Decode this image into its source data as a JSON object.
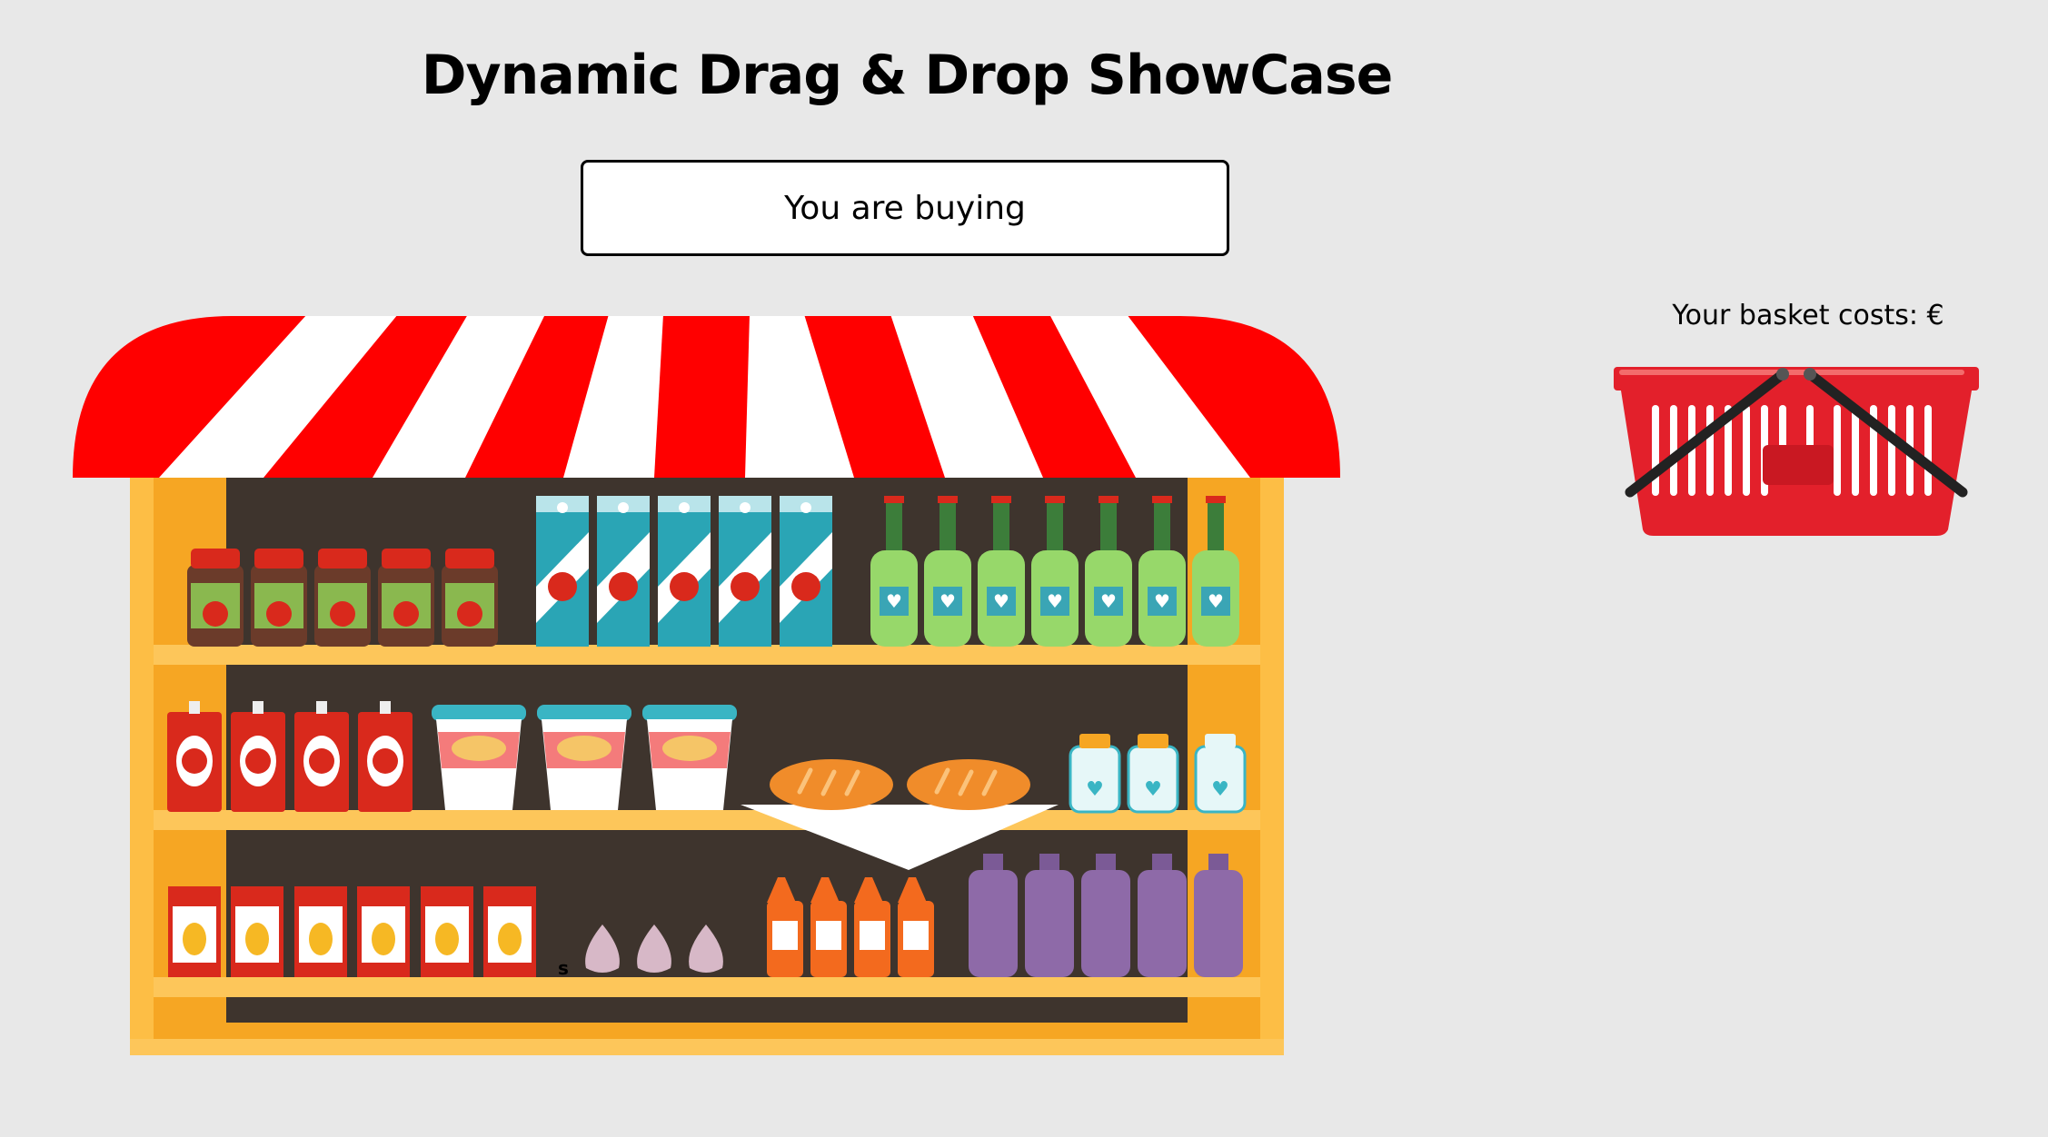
{
  "page": {
    "title": "Dynamic Drag & Drop ShowCase",
    "buying_label": "You are buying",
    "basket_label": "Your basket costs: €",
    "stray_text": "s"
  },
  "colors": {
    "background": "#e8e8e8",
    "awning_red": "#ff0000",
    "awning_white": "#ffffff",
    "shelf_wood": "#f6a623",
    "shelf_back": "#3e342d",
    "basket_red": "#e3202b"
  },
  "shelves": [
    {
      "name": "top",
      "items": [
        {
          "kind": "jam-jar",
          "count": 5,
          "icon": "apple-icon"
        },
        {
          "kind": "apple-juice-carton",
          "count": 5,
          "icon": "apple-icon"
        },
        {
          "kind": "green-bottle",
          "count": 7,
          "icon": "heart-icon"
        }
      ]
    },
    {
      "name": "middle",
      "items": [
        {
          "kind": "tomato-sauce-box",
          "count": 4,
          "icon": "tomato-icon"
        },
        {
          "kind": "soup-bucket",
          "count": 3,
          "icon": "bowl-icon"
        },
        {
          "kind": "bread-loaf",
          "count": 2,
          "icon": "bread-icon"
        },
        {
          "kind": "milk-jar",
          "count": 3,
          "icon": "heart-icon"
        }
      ]
    },
    {
      "name": "bottom",
      "items": [
        {
          "kind": "pear-juice-carton",
          "count": 6,
          "icon": "pear-icon"
        },
        {
          "kind": "garlic",
          "count": 3,
          "icon": "garlic-icon"
        },
        {
          "kind": "orange-bottle",
          "count": 4,
          "icon": "label-icon"
        },
        {
          "kind": "purple-bottle",
          "count": 5,
          "icon": "bottle-icon"
        }
      ]
    }
  ]
}
